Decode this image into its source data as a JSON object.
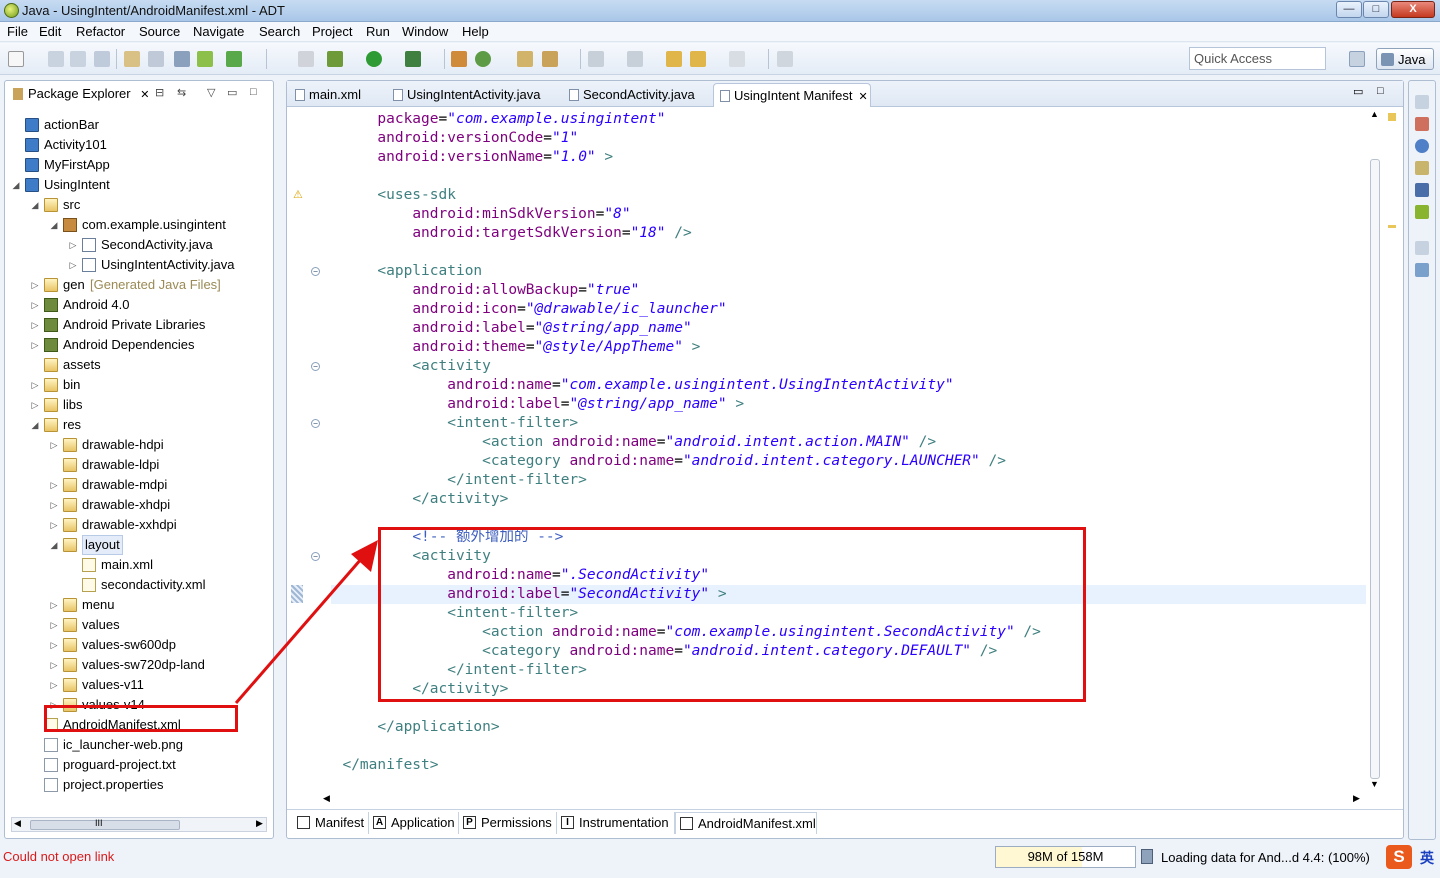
{
  "window": {
    "title": "Java - UsingIntent/AndroidManifest.xml - ADT",
    "buttons": [
      "—",
      "□",
      "X"
    ]
  },
  "menu": [
    "File",
    "Edit",
    "Refactor",
    "Source",
    "Navigate",
    "Search",
    "Project",
    "Run",
    "Window",
    "Help"
  ],
  "quick_access": {
    "placeholder": "Quick Access"
  },
  "perspective": {
    "label": "Java"
  },
  "package_explorer": {
    "tab_label": "Package Explorer",
    "tree": [
      {
        "label": "actionBar",
        "level": 0,
        "icon": "project-icon",
        "arrow": ""
      },
      {
        "label": "Activity101",
        "level": 0,
        "icon": "project-icon",
        "arrow": ""
      },
      {
        "label": "MyFirstApp",
        "level": 0,
        "icon": "project-icon",
        "arrow": ""
      },
      {
        "label": "UsingIntent",
        "level": 0,
        "icon": "project-icon",
        "arrow": "open"
      },
      {
        "label": "src",
        "level": 1,
        "icon": "folder-icon",
        "arrow": "open"
      },
      {
        "label": "com.example.usingintent",
        "level": 2,
        "icon": "package-icon",
        "arrow": "open"
      },
      {
        "label": "SecondActivity.java",
        "level": 3,
        "icon": "java-file-icon",
        "arrow": "closed"
      },
      {
        "label": "UsingIntentActivity.java",
        "level": 3,
        "icon": "java-file-icon",
        "arrow": "closed"
      },
      {
        "label": "gen",
        "suffix": "[Generated Java Files]",
        "level": 1,
        "icon": "folder-icon",
        "arrow": "closed"
      },
      {
        "label": "Android 4.0",
        "level": 1,
        "icon": "library-icon",
        "arrow": "closed"
      },
      {
        "label": "Android Private Libraries",
        "level": 1,
        "icon": "library-icon",
        "arrow": "closed"
      },
      {
        "label": "Android Dependencies",
        "level": 1,
        "icon": "library-icon",
        "arrow": "closed"
      },
      {
        "label": "assets",
        "level": 1,
        "icon": "folder-icon",
        "arrow": ""
      },
      {
        "label": "bin",
        "level": 1,
        "icon": "folder-icon",
        "arrow": "closed"
      },
      {
        "label": "libs",
        "level": 1,
        "icon": "folder-icon",
        "arrow": "closed"
      },
      {
        "label": "res",
        "level": 1,
        "icon": "folder-icon",
        "arrow": "open"
      },
      {
        "label": "drawable-hdpi",
        "level": 2,
        "icon": "folder-icon",
        "arrow": "closed"
      },
      {
        "label": "drawable-ldpi",
        "level": 2,
        "icon": "folder-icon",
        "arrow": ""
      },
      {
        "label": "drawable-mdpi",
        "level": 2,
        "icon": "folder-icon",
        "arrow": "closed"
      },
      {
        "label": "drawable-xhdpi",
        "level": 2,
        "icon": "folder-icon",
        "arrow": "closed"
      },
      {
        "label": "drawable-xxhdpi",
        "level": 2,
        "icon": "folder-icon",
        "arrow": "closed"
      },
      {
        "label": "layout",
        "level": 2,
        "icon": "folder-icon",
        "arrow": "open",
        "selected": true
      },
      {
        "label": "main.xml",
        "level": 3,
        "icon": "xml-file-icon",
        "arrow": ""
      },
      {
        "label": "secondactivity.xml",
        "level": 3,
        "icon": "xml-file-icon",
        "arrow": ""
      },
      {
        "label": "menu",
        "level": 2,
        "icon": "folder-icon",
        "arrow": "closed"
      },
      {
        "label": "values",
        "level": 2,
        "icon": "folder-icon",
        "arrow": "closed"
      },
      {
        "label": "values-sw600dp",
        "level": 2,
        "icon": "folder-icon",
        "arrow": "closed"
      },
      {
        "label": "values-sw720dp-land",
        "level": 2,
        "icon": "folder-icon",
        "arrow": "closed"
      },
      {
        "label": "values-v11",
        "level": 2,
        "icon": "folder-icon",
        "arrow": "closed"
      },
      {
        "label": "values-v14",
        "level": 2,
        "icon": "folder-icon",
        "arrow": "closed"
      },
      {
        "label": "AndroidManifest.xml",
        "level": 1,
        "icon": "xml-file-icon",
        "arrow": ""
      },
      {
        "label": "ic_launcher-web.png",
        "level": 1,
        "icon": "image-file-icon",
        "arrow": ""
      },
      {
        "label": "proguard-project.txt",
        "level": 1,
        "icon": "text-file-icon",
        "arrow": ""
      },
      {
        "label": "project.properties",
        "level": 1,
        "icon": "text-file-icon",
        "arrow": ""
      }
    ],
    "scroll_thumb": "III"
  },
  "editor": {
    "tabs": [
      "main.xml",
      "UsingIntentActivity.java",
      "SecondActivity.java",
      "UsingIntent Manifest"
    ],
    "active_tab": 3,
    "lines": [
      [
        [
          "",
          "      "
        ],
        [
          "a",
          "package"
        ],
        [
          "",
          "="
        ],
        [
          "v",
          "\"com.example.usingintent\""
        ]
      ],
      [
        [
          "",
          "      "
        ],
        [
          "a",
          "android:versionCode"
        ],
        [
          "",
          "="
        ],
        [
          "v",
          "\"1\""
        ]
      ],
      [
        [
          "",
          "      "
        ],
        [
          "a",
          "android:versionName"
        ],
        [
          "",
          "="
        ],
        [
          "v",
          "\"1.0\""
        ],
        [
          "t",
          " >"
        ]
      ],
      [
        [
          "",
          ""
        ]
      ],
      [
        [
          "",
          "      "
        ],
        [
          "t",
          "<uses-sdk"
        ]
      ],
      [
        [
          "",
          "          "
        ],
        [
          "a",
          "android:minSdkVersion"
        ],
        [
          "",
          "="
        ],
        [
          "v",
          "\"8\""
        ]
      ],
      [
        [
          "",
          "          "
        ],
        [
          "a",
          "android:targetSdkVersion"
        ],
        [
          "",
          "="
        ],
        [
          "v",
          "\"18\""
        ],
        [
          "t",
          " />"
        ]
      ],
      [
        [
          "",
          ""
        ]
      ],
      [
        [
          "",
          "      "
        ],
        [
          "t",
          "<application"
        ]
      ],
      [
        [
          "",
          "          "
        ],
        [
          "a",
          "android:allowBackup"
        ],
        [
          "",
          "="
        ],
        [
          "v",
          "\"true\""
        ]
      ],
      [
        [
          "",
          "          "
        ],
        [
          "a",
          "android:icon"
        ],
        [
          "",
          "="
        ],
        [
          "v",
          "\"@drawable/ic_launcher\""
        ]
      ],
      [
        [
          "",
          "          "
        ],
        [
          "a",
          "android:label"
        ],
        [
          "",
          "="
        ],
        [
          "v",
          "\"@string/app_name\""
        ]
      ],
      [
        [
          "",
          "          "
        ],
        [
          "a",
          "android:theme"
        ],
        [
          "",
          "="
        ],
        [
          "v",
          "\"@style/AppTheme\""
        ],
        [
          "t",
          " >"
        ]
      ],
      [
        [
          "",
          "          "
        ],
        [
          "t",
          "<activity"
        ]
      ],
      [
        [
          "",
          "              "
        ],
        [
          "a",
          "android:name"
        ],
        [
          "",
          "="
        ],
        [
          "v",
          "\"com.example.usingintent.UsingIntentActivity\""
        ]
      ],
      [
        [
          "",
          "              "
        ],
        [
          "a",
          "android:label"
        ],
        [
          "",
          "="
        ],
        [
          "v",
          "\"@string/app_name\""
        ],
        [
          "t",
          " >"
        ]
      ],
      [
        [
          "",
          "              "
        ],
        [
          "t",
          "<intent-filter>"
        ]
      ],
      [
        [
          "",
          "                  "
        ],
        [
          "t",
          "<action "
        ],
        [
          "a",
          "android:name"
        ],
        [
          "",
          "="
        ],
        [
          "v",
          "\"android.intent.action.MAIN\""
        ],
        [
          "t",
          " />"
        ]
      ],
      [
        [
          "",
          "                  "
        ],
        [
          "t",
          "<category "
        ],
        [
          "a",
          "android:name"
        ],
        [
          "",
          "="
        ],
        [
          "v",
          "\"android.intent.category.LAUNCHER\""
        ],
        [
          "t",
          " />"
        ]
      ],
      [
        [
          "",
          "              "
        ],
        [
          "t",
          "</intent-filter>"
        ]
      ],
      [
        [
          "",
          "          "
        ],
        [
          "t",
          "</activity>"
        ]
      ],
      [
        [
          "",
          ""
        ]
      ],
      [
        [
          "",
          "          "
        ],
        [
          "c",
          "<!-- 额外增加的 -->"
        ]
      ],
      [
        [
          "",
          "          "
        ],
        [
          "t",
          "<activity"
        ]
      ],
      [
        [
          "",
          "              "
        ],
        [
          "a",
          "android:name"
        ],
        [
          "",
          "="
        ],
        [
          "v",
          "\".SecondActivity\""
        ]
      ],
      [
        [
          "",
          "              "
        ],
        [
          "a",
          "android:label"
        ],
        [
          "",
          "="
        ],
        [
          "v",
          "\"SecondActivity\""
        ],
        [
          "t",
          " >"
        ]
      ],
      [
        [
          "",
          "              "
        ],
        [
          "t",
          "<intent-filter>"
        ]
      ],
      [
        [
          "",
          "                  "
        ],
        [
          "t",
          "<action "
        ],
        [
          "a",
          "android:name"
        ],
        [
          "",
          "="
        ],
        [
          "v",
          "\"com.example.usingintent.SecondActivity\""
        ],
        [
          "t",
          " />"
        ]
      ],
      [
        [
          "",
          "                  "
        ],
        [
          "t",
          "<category "
        ],
        [
          "a",
          "android:name"
        ],
        [
          "",
          "="
        ],
        [
          "v",
          "\"android.intent.category.DEFAULT\""
        ],
        [
          "t",
          " />"
        ]
      ],
      [
        [
          "",
          "              "
        ],
        [
          "t",
          "</intent-filter>"
        ]
      ],
      [
        [
          "",
          "          "
        ],
        [
          "t",
          "</activity>"
        ]
      ],
      [
        [
          "",
          ""
        ]
      ],
      [
        [
          "",
          "      "
        ],
        [
          "t",
          "</application>"
        ]
      ],
      [
        [
          "",
          ""
        ]
      ],
      [
        [
          "",
          "  "
        ],
        [
          "t",
          "</manifest>"
        ]
      ]
    ],
    "highlighted_line": 25,
    "bottom_tabs": [
      {
        "label": "Manifest",
        "icon": "manifest-icon",
        "glyph": ""
      },
      {
        "label": "Application",
        "icon": "application-icon",
        "glyph": "A"
      },
      {
        "label": "Permissions",
        "icon": "permissions-icon",
        "glyph": "P"
      },
      {
        "label": "Instrumentation",
        "icon": "instrumentation-icon",
        "glyph": "I"
      },
      {
        "label": "AndroidManifest.xml",
        "icon": "xml-file-icon",
        "glyph": ""
      }
    ],
    "active_bottom_tab": 4
  },
  "status": {
    "message": "Could not open link",
    "heap": "98M of 158M",
    "heap_used_fraction": 0.62,
    "job": "Loading data for And...d 4.4: (100%)",
    "ime_logo": "S",
    "ime_mode": "英"
  },
  "colors": {
    "annotation": "#e01010",
    "xml_tag": "#3f7f7f",
    "xml_attr": "#7f007f",
    "xml_value": "#2a00ff",
    "xml_comment": "#3f5fbf",
    "error_text": "#d91a1a"
  }
}
